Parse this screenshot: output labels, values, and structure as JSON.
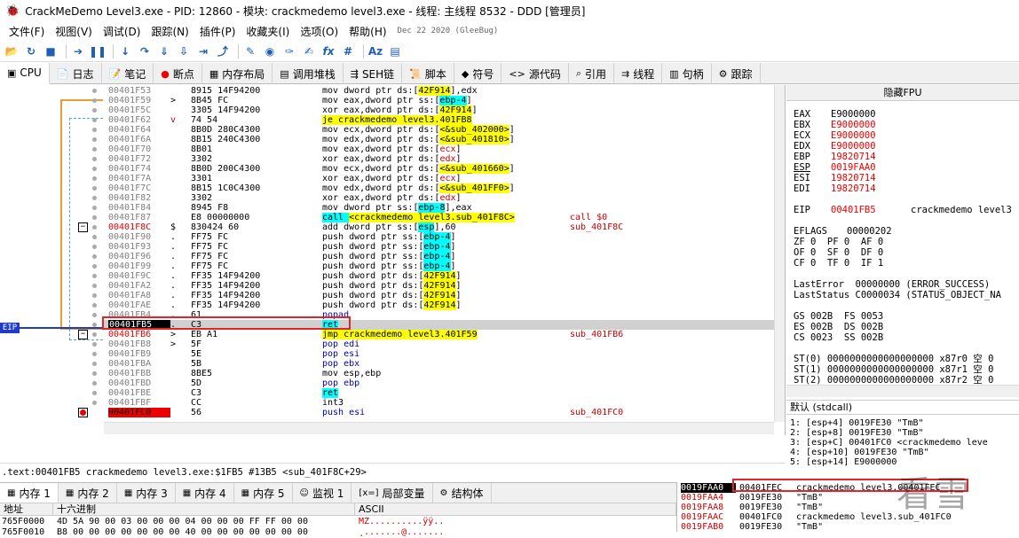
{
  "title": "CrackMeDemo Level3.exe - PID: 12860 - 模块: crackmedemo level3.exe - 线程: 主线程 8532 - DDD [管理员]",
  "menu": [
    "文件(F)",
    "视图(V)",
    "调试(D)",
    "跟踪(N)",
    "插件(P)",
    "收藏夹(I)",
    "选项(O)",
    "帮助(H)"
  ],
  "build_date": "Dec 22 2020 (GleeBug)",
  "tabs": [
    {
      "icon": "cpu-icon",
      "glyph": "▣",
      "label": "CPU"
    },
    {
      "icon": "log-icon",
      "glyph": "📄",
      "label": "日志"
    },
    {
      "icon": "notes-icon",
      "glyph": "📝",
      "label": "笔记"
    },
    {
      "icon": "breakpoint-icon",
      "glyph": "●",
      "label": "断点"
    },
    {
      "icon": "memory-map-icon",
      "glyph": "▦",
      "label": "内存布局"
    },
    {
      "icon": "callstack-icon",
      "glyph": "▤",
      "label": "调用堆栈"
    },
    {
      "icon": "seh-icon",
      "glyph": "⇶",
      "label": "SEH链"
    },
    {
      "icon": "script-icon",
      "glyph": "📜",
      "label": "脚本"
    },
    {
      "icon": "symbols-icon",
      "glyph": "◆",
      "label": "符号"
    },
    {
      "icon": "source-icon",
      "glyph": "<>",
      "label": "源代码"
    },
    {
      "icon": "references-icon",
      "glyph": "⌕",
      "label": "引用"
    },
    {
      "icon": "threads-icon",
      "glyph": "⇉",
      "label": "线程"
    },
    {
      "icon": "handles-icon",
      "glyph": "▥",
      "label": "句柄"
    },
    {
      "icon": "trace-icon",
      "glyph": "⚙",
      "label": "跟踪"
    }
  ],
  "eip_label": "EIP",
  "disasm": [
    {
      "addr": "00401F53",
      "arrow": "",
      "bytes": "8915 14F94200",
      "instr": [
        [
          "mov dword ptr ds:[",
          ""
        ],
        [
          "42F914",
          "y"
        ],
        [
          "],edx",
          ""
        ]
      ]
    },
    {
      "addr": "00401F59",
      "arrow": ">",
      "bytes": "8B45 FC",
      "instr": [
        [
          "mov eax,dword ptr ss:[",
          ""
        ],
        [
          "ebp-4",
          "c"
        ],
        [
          "]",
          ""
        ]
      ]
    },
    {
      "addr": "00401F5C",
      "arrow": "",
      "bytes": "3305 14F94200",
      "instr": [
        [
          "xor eax,dword ptr ds:[",
          ""
        ],
        [
          "42F914",
          "y"
        ],
        [
          "]",
          ""
        ]
      ]
    },
    {
      "addr": "00401F62",
      "arrow": "v",
      "bytes": "74 54",
      "instr": [
        [
          "je crackmedemo level3.401FB8",
          "y"
        ]
      ]
    },
    {
      "addr": "00401F64",
      "arrow": "",
      "bytes": "8B0D 280C4300",
      "instr": [
        [
          "mov ecx,dword ptr ds:[",
          ""
        ],
        [
          "<&sub_402000>",
          "y"
        ],
        [
          "]",
          ""
        ]
      ]
    },
    {
      "addr": "00401F6A",
      "arrow": "",
      "bytes": "8B15 240C4300",
      "instr": [
        [
          "mov edx,dword ptr ds:[",
          ""
        ],
        [
          "<&sub_401810>",
          "y"
        ],
        [
          "]",
          ""
        ]
      ]
    },
    {
      "addr": "00401F70",
      "arrow": "",
      "bytes": "8B01",
      "instr": [
        [
          "mov eax,dword ptr ds:[",
          ""
        ],
        [
          "ecx",
          "r"
        ],
        [
          "]",
          ""
        ]
      ]
    },
    {
      "addr": "00401F72",
      "arrow": "",
      "bytes": "3302",
      "instr": [
        [
          "xor eax,dword ptr ds:[",
          ""
        ],
        [
          "edx",
          "r"
        ],
        [
          "]",
          ""
        ]
      ]
    },
    {
      "addr": "00401F74",
      "arrow": "",
      "bytes": "8B0D 200C4300",
      "instr": [
        [
          "mov ecx,dword ptr ds:[",
          ""
        ],
        [
          "<&sub_401660>",
          "y"
        ],
        [
          "]",
          ""
        ]
      ]
    },
    {
      "addr": "00401F7A",
      "arrow": "",
      "bytes": "3301",
      "instr": [
        [
          "xor eax,dword ptr ds:[",
          ""
        ],
        [
          "ecx",
          "r"
        ],
        [
          "]",
          ""
        ]
      ]
    },
    {
      "addr": "00401F7C",
      "arrow": "",
      "bytes": "8B15 1C0C4300",
      "instr": [
        [
          "mov edx,dword ptr ds:[",
          ""
        ],
        [
          "<&sub_401FF0>",
          "y"
        ],
        [
          "]",
          ""
        ]
      ]
    },
    {
      "addr": "00401F82",
      "arrow": "",
      "bytes": "3302",
      "instr": [
        [
          "xor eax,dword ptr ds:[",
          ""
        ],
        [
          "edx",
          "r"
        ],
        [
          "]",
          ""
        ]
      ]
    },
    {
      "addr": "00401F84",
      "arrow": "",
      "bytes": "8945 F8",
      "instr": [
        [
          "mov dword ptr ss:[",
          ""
        ],
        [
          "ebp-8",
          "c"
        ],
        [
          "],eax",
          ""
        ]
      ]
    },
    {
      "addr": "00401F87",
      "arrow": "",
      "bytes": "E8 00000000",
      "instr": [
        [
          "call ",
          "cb"
        ],
        [
          "<crackmedemo level3.sub_401F8C>",
          "y"
        ]
      ],
      "cmt": "call $0"
    },
    {
      "addr": "00401F8C",
      "arrow": "$",
      "bytes": "830424 60",
      "instr": [
        [
          "add dword ptr ss:[",
          ""
        ],
        [
          "esp",
          "c"
        ],
        [
          "],60",
          ""
        ]
      ],
      "cmt": "sub_401F8C",
      "red": true,
      "box": true
    },
    {
      "addr": "00401F90",
      "arrow": ".",
      "bytes": "FF75 FC",
      "instr": [
        [
          "push dword ptr ss:[",
          ""
        ],
        [
          "ebp-4",
          "c"
        ],
        [
          "]",
          ""
        ]
      ]
    },
    {
      "addr": "00401F93",
      "arrow": ".",
      "bytes": "FF75 FC",
      "instr": [
        [
          "push dword ptr ss:[",
          ""
        ],
        [
          "ebp-4",
          "c"
        ],
        [
          "]",
          ""
        ]
      ]
    },
    {
      "addr": "00401F96",
      "arrow": ".",
      "bytes": "FF75 FC",
      "instr": [
        [
          "push dword ptr ss:[",
          ""
        ],
        [
          "ebp-4",
          "c"
        ],
        [
          "]",
          ""
        ]
      ]
    },
    {
      "addr": "00401F99",
      "arrow": ".",
      "bytes": "FF75 FC",
      "instr": [
        [
          "push dword ptr ss:[",
          ""
        ],
        [
          "ebp-4",
          "c"
        ],
        [
          "]",
          ""
        ]
      ]
    },
    {
      "addr": "00401F9C",
      "arrow": ".",
      "bytes": "FF35 14F94200",
      "instr": [
        [
          "push dword ptr ds:[",
          ""
        ],
        [
          "42F914",
          "y"
        ],
        [
          "]",
          ""
        ]
      ]
    },
    {
      "addr": "00401FA2",
      "arrow": ".",
      "bytes": "FF35 14F94200",
      "instr": [
        [
          "push dword ptr ds:[",
          ""
        ],
        [
          "42F914",
          "y"
        ],
        [
          "]",
          ""
        ]
      ]
    },
    {
      "addr": "00401FA8",
      "arrow": ".",
      "bytes": "FF35 14F94200",
      "instr": [
        [
          "push dword ptr ds:[",
          ""
        ],
        [
          "42F914",
          "y"
        ],
        [
          "]",
          ""
        ]
      ]
    },
    {
      "addr": "00401FAE",
      "arrow": ".",
      "bytes": "FF35 14F94200",
      "instr": [
        [
          "push dword ptr ds:[",
          ""
        ],
        [
          "42F914",
          "y"
        ],
        [
          "]",
          ""
        ]
      ]
    },
    {
      "addr": "00401FB4",
      "arrow": ".",
      "bytes": "61",
      "instr": [
        [
          "popad",
          "b"
        ]
      ]
    },
    {
      "addr": "00401FB5",
      "arrow": ".",
      "bytes": "C3",
      "instr": [
        [
          "ret",
          "c"
        ]
      ],
      "eip": true
    },
    {
      "addr": "00401FB6",
      "arrow": ">",
      "bytes": "EB A1",
      "instr": [
        [
          "jmp crackmedemo level3.401F59",
          "y"
        ]
      ],
      "cmt": "sub_401FB6",
      "red": true,
      "box": true
    },
    {
      "addr": "00401FB8",
      "arrow": ">",
      "bytes": "5F",
      "instr": [
        [
          "pop edi",
          "b"
        ]
      ]
    },
    {
      "addr": "00401FB9",
      "arrow": "",
      "bytes": "5E",
      "instr": [
        [
          "pop esi",
          "b"
        ]
      ]
    },
    {
      "addr": "00401FBA",
      "arrow": "",
      "bytes": "5B",
      "instr": [
        [
          "pop ebx",
          "b"
        ]
      ]
    },
    {
      "addr": "00401FBB",
      "arrow": "",
      "bytes": "8BE5",
      "instr": [
        [
          "mov esp,ebp",
          ""
        ]
      ]
    },
    {
      "addr": "00401FBD",
      "arrow": "",
      "bytes": "5D",
      "instr": [
        [
          "pop ebp",
          "b"
        ]
      ]
    },
    {
      "addr": "00401FBE",
      "arrow": "",
      "bytes": "C3",
      "instr": [
        [
          "ret",
          "c"
        ]
      ]
    },
    {
      "addr": "00401FBF",
      "arrow": "",
      "bytes": "CC",
      "instr": [
        [
          "int3",
          ""
        ]
      ]
    },
    {
      "addr": "00401FC0",
      "arrow": "",
      "bytes": "56",
      "instr": [
        [
          "push esi",
          "b"
        ]
      ],
      "cmt": "sub_401FC0",
      "bp": true,
      "box": true
    }
  ],
  "status_line": ".text:00401FB5 crackmedemo level3.exe:$1FB5 #13B5 <sub_401F8C+29>",
  "reg_panel_title": "隐藏FPU",
  "registers": [
    {
      "name": "EAX",
      "value": "E9000000",
      "changed": false
    },
    {
      "name": "EBX",
      "value": "E9000000",
      "changed": true
    },
    {
      "name": "ECX",
      "value": "E9000000",
      "changed": true
    },
    {
      "name": "EDX",
      "value": "E9000000",
      "changed": true
    },
    {
      "name": "EBP",
      "value": "19820714",
      "changed": true
    },
    {
      "name": "ESP",
      "value": "0019FAA0",
      "changed": true
    },
    {
      "name": "ESI",
      "value": "19820714",
      "changed": true
    },
    {
      "name": "EDI",
      "value": "19820714",
      "changed": true
    }
  ],
  "eip_reg": {
    "name": "EIP",
    "value": "00401FB5",
    "sym": "crackmedemo level3"
  },
  "eflags": {
    "name": "EFLAGS",
    "value": "00000202"
  },
  "flags": [
    "ZF 0  PF 0  AF 0",
    "OF 0  SF 0  DF 0",
    "CF 0  TF 0  IF 1"
  ],
  "last_error": "LastError  00000000 (ERROR_SUCCESS)",
  "last_status": "LastStatus C0000034 (STATUS_OBJECT_NA",
  "segs": [
    "GS 002B  FS 0053",
    "ES 002B  DS 002B",
    "CS 0023  SS 002B"
  ],
  "fpu": [
    "ST(0) 0000000000000000000 x87r0 空 0",
    "ST(1) 0000000000000000000 x87r1 空 0",
    "ST(2) 0000000000000000000 x87r2 空 0"
  ],
  "callconv": "默认 (stdcall)",
  "args": [
    "1: [esp+4] 0019FE30 \"TmB\"",
    "2: [esp+8] 0019FE30 \"TmB\"",
    "3: [esp+C] 00401FC0 <crackmedemo leve",
    "4: [esp+10] 0019FE30 \"TmB\"",
    "5: [esp+14] E9000000"
  ],
  "bottom_tabs": [
    {
      "glyph": "▦",
      "label": "内存 1"
    },
    {
      "glyph": "▦",
      "label": "内存 2"
    },
    {
      "glyph": "▦",
      "label": "内存 3"
    },
    {
      "glyph": "▦",
      "label": "内存 4"
    },
    {
      "glyph": "▦",
      "label": "内存 5"
    },
    {
      "glyph": "☺",
      "label": "监视 1"
    },
    {
      "glyph": "[x=]",
      "label": "局部变量"
    },
    {
      "glyph": "⚙",
      "label": "结构体"
    }
  ],
  "hex_headers": [
    "地址",
    "十六进制",
    "ASCII"
  ],
  "hex_rows": [
    {
      "addr": "765F0000",
      "hex": "4D 5A 90 00 03 00 00 00 04 00 00 00 FF FF 00 00",
      "ascii": "MZ..........ÿÿ.."
    },
    {
      "addr": "765F0010",
      "hex": "B8 00 00 00 00 00 00 00 40 00 00 00 00 00 00 00",
      "ascii": "¸.......@......."
    }
  ],
  "stack": [
    {
      "addr": "0019FAA0",
      "val": "00401FEC",
      "cmt": "crackmedemo level3.00401FEC",
      "cur": true
    },
    {
      "addr": "0019FAA4",
      "val": "0019FE30",
      "cmt": "\"TmB\""
    },
    {
      "addr": "0019FAA8",
      "val": "0019FE30",
      "cmt": "\"TmB\""
    },
    {
      "addr": "0019FAAC",
      "val": "00401FC0",
      "cmt": "crackmedemo level3.sub_401FC0"
    },
    {
      "addr": "0019FAB0",
      "val": "0019FE30",
      "cmt": "\"TmB\""
    }
  ],
  "watermark": "看雪"
}
